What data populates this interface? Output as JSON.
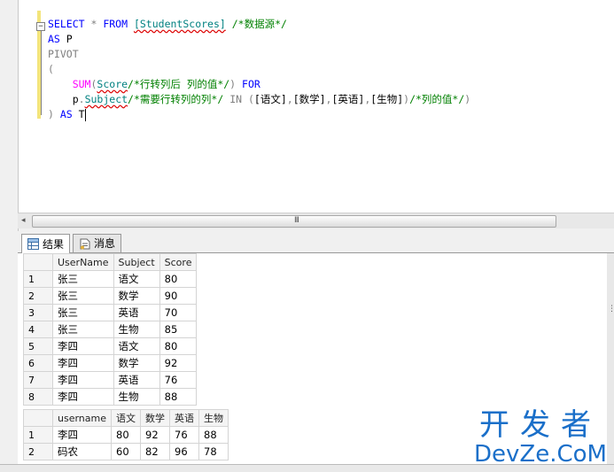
{
  "editor": {
    "lines": [
      {
        "parts": [
          {
            "cls": "kw",
            "text": "SELECT "
          },
          {
            "cls": "gray",
            "text": "* "
          },
          {
            "cls": "kw",
            "text": "FROM "
          },
          {
            "cls": "obj",
            "text": "[StudentScores]"
          },
          {
            "cls": "txt",
            "text": " "
          },
          {
            "cls": "cm",
            "text": "/*数据源*/"
          }
        ]
      },
      {
        "parts": [
          {
            "cls": "kw",
            "text": "AS "
          },
          {
            "cls": "txt",
            "text": "P"
          }
        ]
      },
      {
        "parts": [
          {
            "cls": "gray",
            "text": "PIVOT"
          }
        ]
      },
      {
        "parts": [
          {
            "cls": "gray",
            "text": "("
          }
        ]
      },
      {
        "parts": [
          {
            "cls": "txt",
            "text": "    "
          },
          {
            "cls": "fn",
            "text": "SUM"
          },
          {
            "cls": "gray",
            "text": "("
          },
          {
            "cls": "obj",
            "text": "Score"
          },
          {
            "cls": "cm",
            "text": "/*行转列后 列的值*/"
          },
          {
            "cls": "gray",
            "text": ") "
          },
          {
            "cls": "kw",
            "text": "FOR"
          }
        ]
      },
      {
        "parts": [
          {
            "cls": "txt",
            "text": "    "
          },
          {
            "cls": "txt",
            "text": "p"
          },
          {
            "cls": "gray",
            "text": "."
          },
          {
            "cls": "obj",
            "text": "Subject"
          },
          {
            "cls": "cm",
            "text": "/*需要行转列的列*/"
          },
          {
            "cls": "txt",
            "text": " "
          },
          {
            "cls": "gray",
            "text": "IN ("
          },
          {
            "cls": "txt",
            "text": "[语文]"
          },
          {
            "cls": "gray",
            "text": ","
          },
          {
            "cls": "txt",
            "text": "[数学]"
          },
          {
            "cls": "gray",
            "text": ","
          },
          {
            "cls": "txt",
            "text": "[英语]"
          },
          {
            "cls": "gray",
            "text": ","
          },
          {
            "cls": "txt",
            "text": "[生物]"
          },
          {
            "cls": "gray",
            "text": ")"
          },
          {
            "cls": "cm",
            "text": "/*列的值*/"
          },
          {
            "cls": "gray",
            "text": ")"
          }
        ]
      },
      {
        "parts": [
          {
            "cls": "gray",
            "text": ") "
          },
          {
            "cls": "kw",
            "text": "AS "
          },
          {
            "cls": "txt",
            "text": "T"
          }
        ]
      }
    ]
  },
  "tabs": [
    {
      "label": "结果",
      "icon": "grid-icon",
      "active": true
    },
    {
      "label": "消息",
      "icon": "message-icon",
      "active": false
    }
  ],
  "grid1": {
    "headers": [
      "UserName",
      "Subject",
      "Score"
    ],
    "rows": [
      [
        "1",
        "张三",
        "语文",
        "80"
      ],
      [
        "2",
        "张三",
        "数学",
        "90"
      ],
      [
        "3",
        "张三",
        "英语",
        "70"
      ],
      [
        "4",
        "张三",
        "生物",
        "85"
      ],
      [
        "5",
        "李四",
        "语文",
        "80"
      ],
      [
        "6",
        "李四",
        "数学",
        "92"
      ],
      [
        "7",
        "李四",
        "英语",
        "76"
      ],
      [
        "8",
        "李四",
        "生物",
        "88"
      ]
    ]
  },
  "grid2": {
    "headers": [
      "username",
      "语文",
      "数学",
      "英语",
      "生物"
    ],
    "rows": [
      [
        "1",
        "李四",
        "80",
        "92",
        "76",
        "88"
      ],
      [
        "2",
        "码农",
        "60",
        "82",
        "96",
        "78"
      ]
    ]
  },
  "watermark": {
    "cn": "开发者",
    "en": "DevZe.CoM"
  },
  "colors": {
    "keyword": "#0000ff",
    "comment": "#008000",
    "function": "#ff00ff",
    "object": "#008080",
    "watermark": "#1a6fc9"
  }
}
